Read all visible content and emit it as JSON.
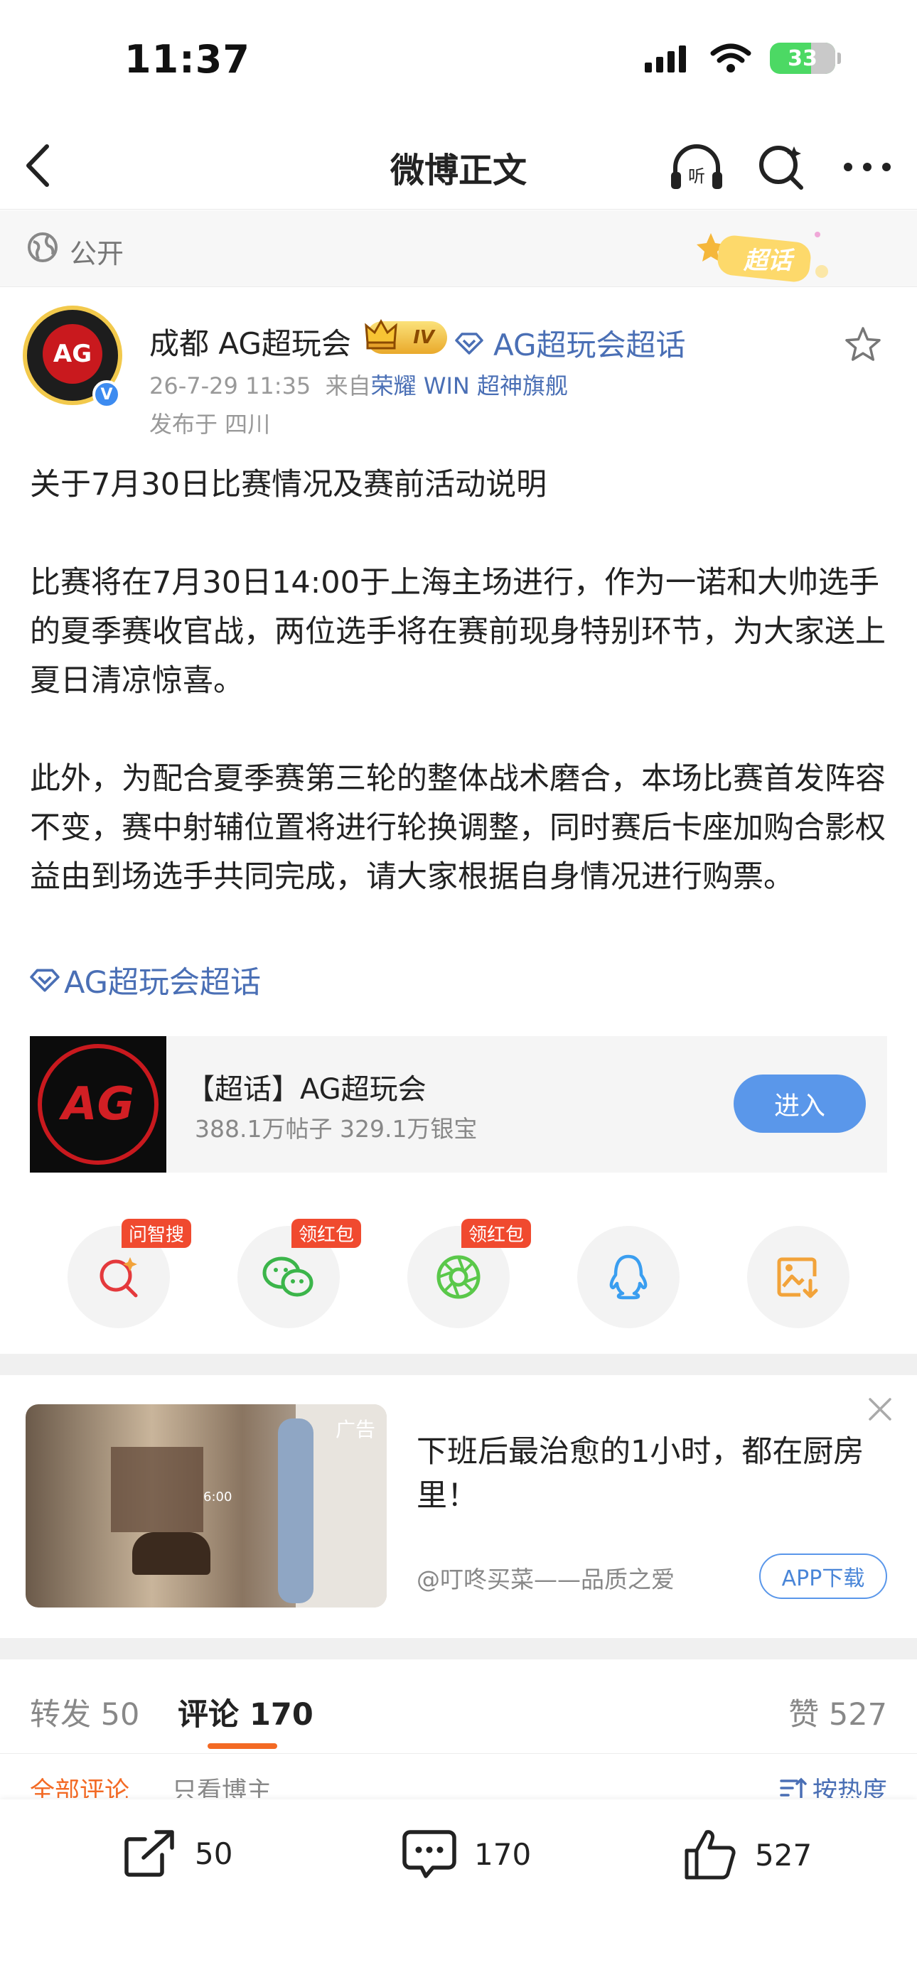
{
  "status_bar": {
    "time": "11:37",
    "battery": "33"
  },
  "navbar": {
    "title": "微博正文"
  },
  "visibility": {
    "label": "公开",
    "topic_badge": "超话"
  },
  "post": {
    "author": "成都 AG超玩会",
    "level": "IV",
    "super_topic": "AG超玩会超话",
    "time": "26-7-29 11:35",
    "source_prefix": "来自",
    "source": "荣耀 WIN 超神旗舰",
    "location": "发布于 四川",
    "paragraphs": [
      "关于7月30日比赛情况及赛前活动说明",
      "比赛将在7月30日14:00于上海主场进行，作为一诺和大帅选手的夏季赛收官战，两位选手将在赛前现身特别环节，为大家送上夏日清凉惊喜。",
      "此外，为配合夏季赛第三轮的整体战术磨合，本场比赛首发阵容不变，赛中射辅位置将进行轮换调整，同时赛后卡座加购合影权益由到场选手共同完成，请大家根据自身情况进行购票。"
    ],
    "topic_tag": "AG超玩会超话"
  },
  "super_topic_card": {
    "title": "【超话】AG超玩会",
    "stats": "388.1万帖子 329.1万银宝",
    "enter": "进入"
  },
  "share_row": [
    {
      "icon": "ask-search-icon",
      "tag": "问智搜",
      "color": "#e4393c"
    },
    {
      "icon": "wechat-icon",
      "tag": "领红包",
      "color": "#3bb54a"
    },
    {
      "icon": "moments-icon",
      "tag": "领红包",
      "color": "#5ac84a"
    },
    {
      "icon": "qq-icon",
      "tag": "",
      "color": "#3a9ef0"
    },
    {
      "icon": "save-image-icon",
      "tag": "",
      "color": "#f2a33a"
    }
  ],
  "ad": {
    "label": "广告",
    "clock": "6:00",
    "title": "下班后最治愈的1小时，都在厨房里！",
    "source": "@叮咚买菜——品质之爱",
    "download": "APP下载"
  },
  "tabs": {
    "repost_label": "转发",
    "repost_count": "50",
    "comment_label": "评论",
    "comment_count": "170",
    "like_label": "赞",
    "like_count": "527"
  },
  "filters": {
    "all": "全部评论",
    "author_only": "只看博主",
    "sort": "按热度"
  },
  "bottom_bar": {
    "repost": "50",
    "comment": "170",
    "like": "527"
  },
  "colors": {
    "link": "#4a6fb5",
    "accent": "#f36a24",
    "button_blue": "#5a97ea"
  }
}
